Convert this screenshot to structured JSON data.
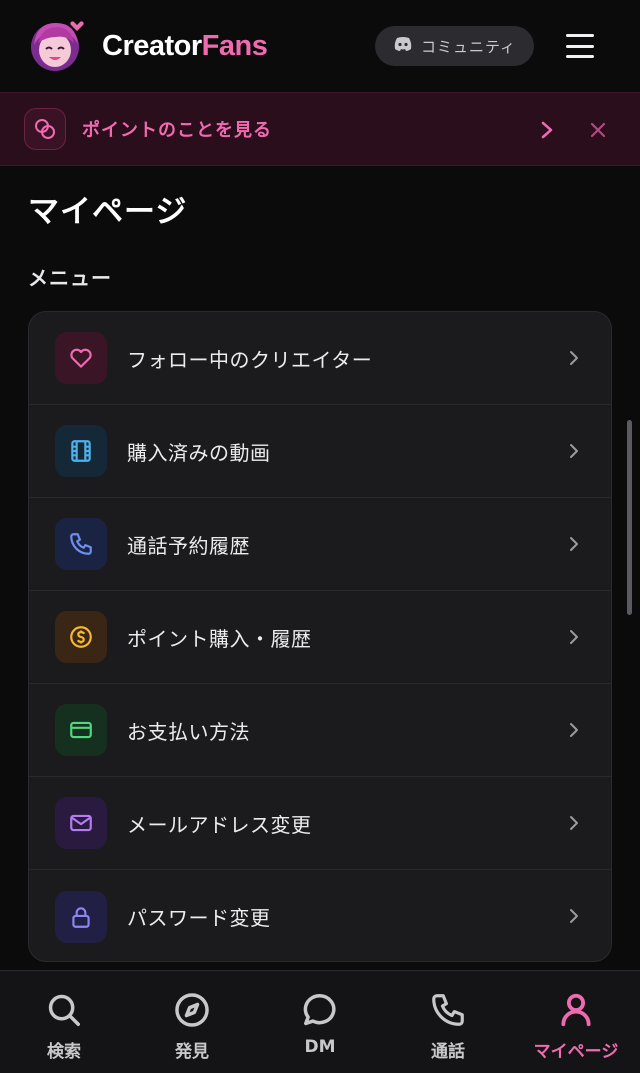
{
  "header": {
    "brand_part1": "Creator",
    "brand_part2": "Fans",
    "community_label": "コミュニティ"
  },
  "banner": {
    "text": "ポイントのことを見る"
  },
  "page": {
    "title": "マイページ",
    "section_title": "メニュー"
  },
  "menu": {
    "items": [
      {
        "label": "フォロー中のクリエイター",
        "icon": "heart-icon",
        "color": "#f06ab0",
        "bg": "#3a1526"
      },
      {
        "label": "購入済みの動画",
        "icon": "film-icon",
        "color": "#4fb0ea",
        "bg": "#142838"
      },
      {
        "label": "通話予約履歴",
        "icon": "phone-icon",
        "color": "#6e8ff0",
        "bg": "#1a2442"
      },
      {
        "label": "ポイント購入・履歴",
        "icon": "coin-icon",
        "color": "#f5b82e",
        "bg": "#3a2614"
      },
      {
        "label": "お支払い方法",
        "icon": "credit-card-icon",
        "color": "#4fd97e",
        "bg": "#16301f"
      },
      {
        "label": "メールアドレス変更",
        "icon": "mail-icon",
        "color": "#b47cf0",
        "bg": "#2a1a40"
      },
      {
        "label": "パスワード変更",
        "icon": "lock-icon",
        "color": "#8c86f2",
        "bg": "#211f44"
      }
    ]
  },
  "nav": {
    "items": [
      {
        "label": "検索",
        "icon": "search-icon",
        "active": false
      },
      {
        "label": "発見",
        "icon": "compass-icon",
        "active": false
      },
      {
        "label": "DM",
        "icon": "chat-bubble-icon",
        "active": false
      },
      {
        "label": "通話",
        "icon": "phone-icon",
        "active": false
      },
      {
        "label": "マイページ",
        "icon": "user-icon",
        "active": true
      }
    ]
  },
  "colors": {
    "accent": "#f06ab0",
    "background": "#0b0b0c",
    "card": "#1b1b1e"
  }
}
